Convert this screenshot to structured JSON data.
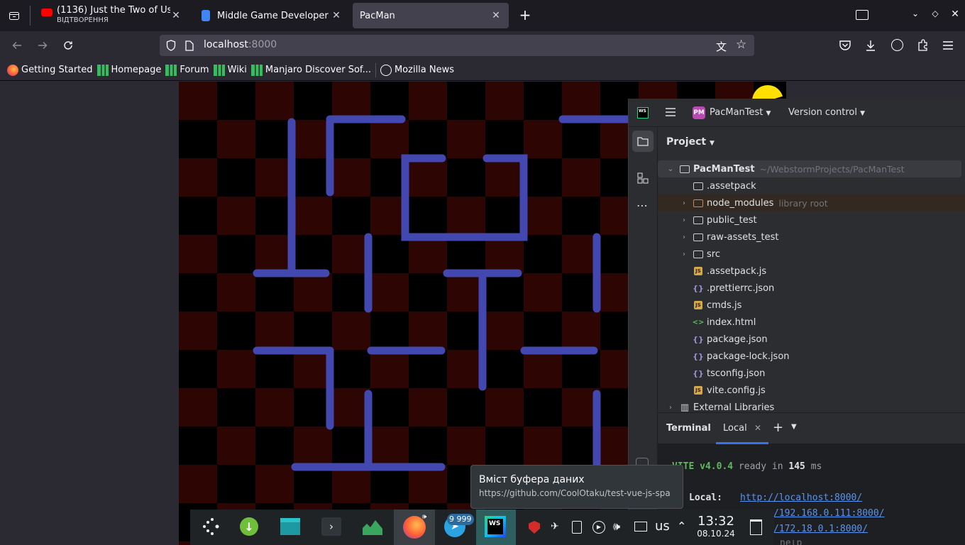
{
  "browser": {
    "tabs": [
      {
        "title": "(1136) Just the Two of Us -",
        "subtitle": "ВІДТВОРЕННЯ",
        "icon": "youtube-icon"
      },
      {
        "title": "Middle Game Developer - C",
        "icon": "document-icon"
      },
      {
        "title": "PacMan",
        "icon": ""
      }
    ],
    "url_host": "localhost",
    "url_port": ":8000",
    "bookmarks": [
      {
        "label": "Getting Started",
        "icon": "firefox-icon"
      },
      {
        "label": "Homepage",
        "icon": "manjaro-icon"
      },
      {
        "label": "Forum",
        "icon": "manjaro-icon"
      },
      {
        "label": "Wiki",
        "icon": "manjaro-icon"
      },
      {
        "label": "Manjaro Discover Sof...",
        "icon": "manjaro-icon"
      },
      {
        "label": "Mozilla News",
        "icon": "globe-icon"
      }
    ]
  },
  "ide": {
    "project_badge": "PM",
    "project_name": "PacManTest",
    "vcs_label": "Version control",
    "panel_title": "Project",
    "tree": [
      {
        "label": "PacManTest",
        "extra": "~/WebstormProjects/PacManTest",
        "type": "folder",
        "level": 0,
        "expand": "open"
      },
      {
        "label": ".assetpack",
        "type": "folder",
        "level": 1,
        "expand": "none"
      },
      {
        "label": "node_modules",
        "extra": "library root",
        "type": "folder-orange",
        "level": 1,
        "expand": "closed"
      },
      {
        "label": "public_test",
        "type": "folder",
        "level": 1,
        "expand": "closed"
      },
      {
        "label": "raw-assets_test",
        "type": "folder",
        "level": 1,
        "expand": "closed"
      },
      {
        "label": "src",
        "type": "folder",
        "level": 1,
        "expand": "closed"
      },
      {
        "label": ".assetpack.js",
        "type": "js",
        "level": 1,
        "expand": "none"
      },
      {
        "label": ".prettierrc.json",
        "type": "json",
        "level": 1,
        "expand": "none"
      },
      {
        "label": "cmds.js",
        "type": "js",
        "level": 1,
        "expand": "none"
      },
      {
        "label": "index.html",
        "type": "html",
        "level": 1,
        "expand": "none"
      },
      {
        "label": "package.json",
        "type": "json",
        "level": 1,
        "expand": "none"
      },
      {
        "label": "package-lock.json",
        "type": "json",
        "level": 1,
        "expand": "none"
      },
      {
        "label": "tsconfig.json",
        "type": "json",
        "level": 1,
        "expand": "none"
      },
      {
        "label": "vite.config.js",
        "type": "js",
        "level": 1,
        "expand": "none"
      },
      {
        "label": "External Libraries",
        "type": "lib",
        "level": 0,
        "expand": "closed"
      }
    ],
    "terminal": {
      "title": "Terminal",
      "tab": "Local",
      "vite": "VITE v4.0.4",
      "ready": "ready in",
      "ms_value": "145",
      "ms_unit": "ms",
      "local_label": "Local:",
      "local_url": "http://localhost:8000/",
      "net1": "/192.168.0.111:8000/",
      "net2": "/172.18.0.1:8000/",
      "help": "help"
    }
  },
  "tooltip": {
    "title": "Вміст буфера даних",
    "url": "https://github.com/CoolOtaku/test-vue-js-spa"
  },
  "taskbar": {
    "telegram_badge": "9 999",
    "layout": "us",
    "time": "13:32",
    "date": "08.10.24"
  },
  "colors": {
    "maze_wall": "#4348b0",
    "board_red": "#2d0502",
    "pacman": "#ffe000",
    "accent": "#3574f0"
  }
}
